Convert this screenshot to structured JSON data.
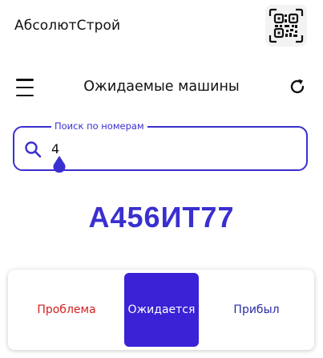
{
  "header": {
    "app_title": "АбсолютСтрой",
    "qr_icon": "qr-code-icon"
  },
  "nav": {
    "title": "Ожидаемые машины",
    "menu_icon": "hamburger-menu-icon",
    "refresh_icon": "refresh-icon"
  },
  "search": {
    "label": "Поиск по номерам",
    "value": "4",
    "icon": "search-icon"
  },
  "plate": {
    "number": "А456ИТ77"
  },
  "status": {
    "options": [
      {
        "label": "Проблема",
        "color": "#d22020"
      },
      {
        "label": "Ожидается",
        "color": "#ffffff",
        "selected": true
      },
      {
        "label": "Прибыл",
        "color": "#2a2aa6"
      }
    ]
  },
  "colors": {
    "accent": "#3a2fcf",
    "selected_bg": "#3a22d6",
    "problem": "#d22020"
  }
}
